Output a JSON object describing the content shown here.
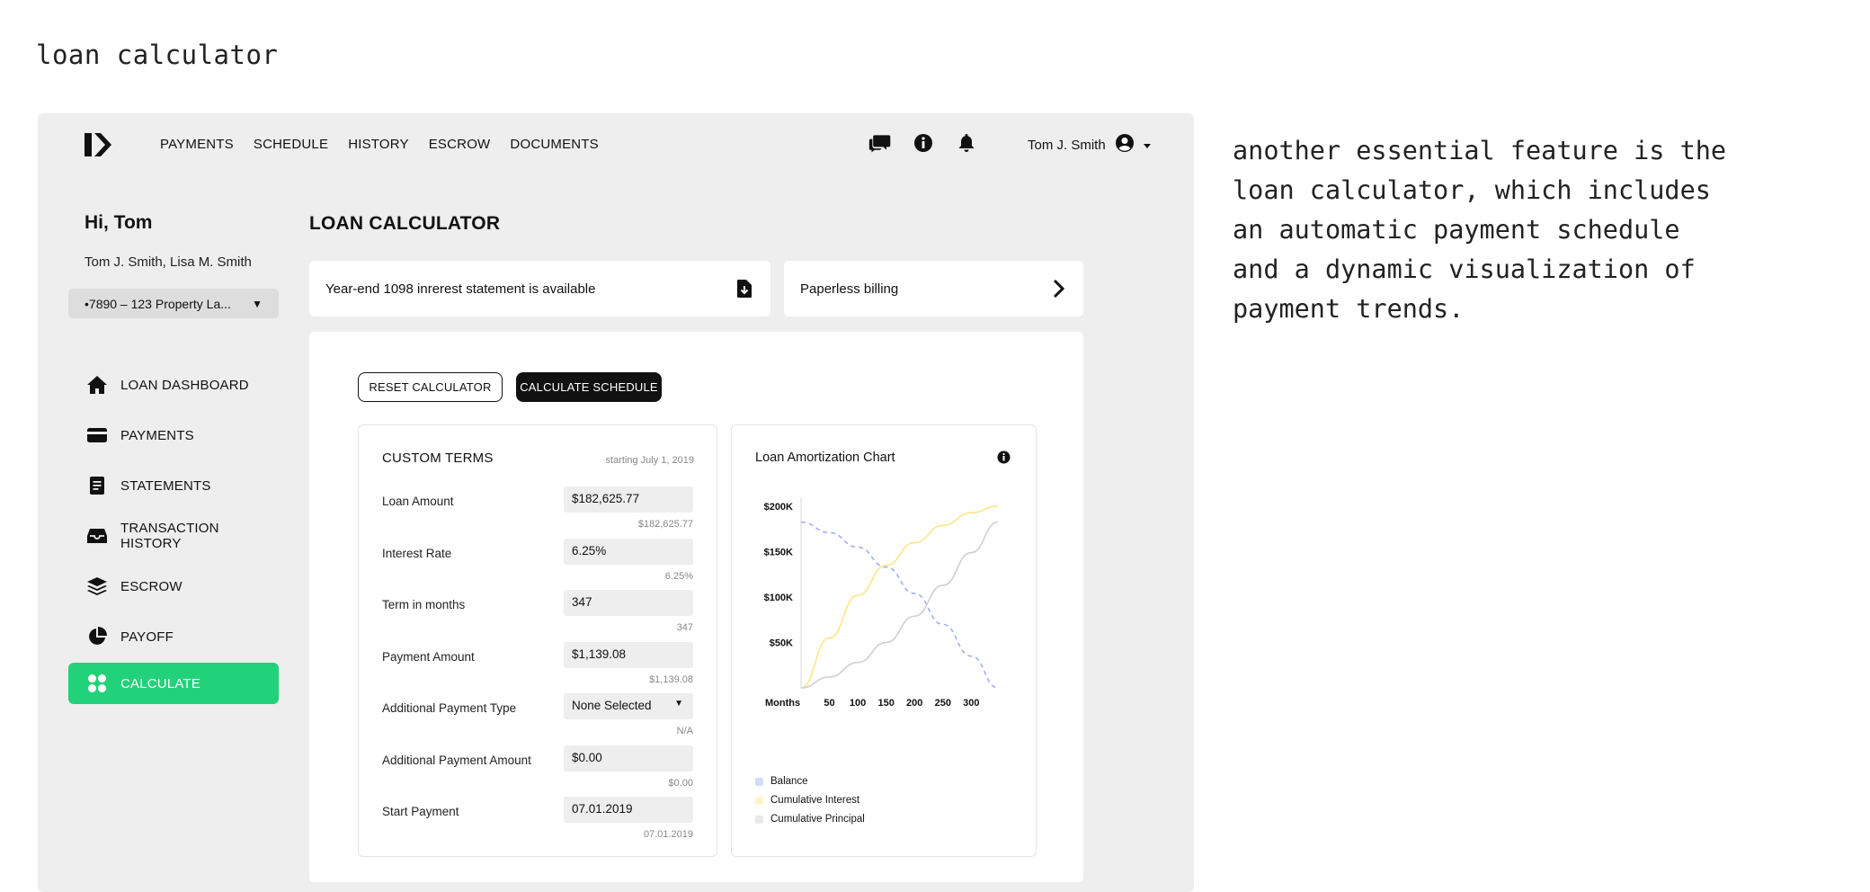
{
  "page": {
    "heading": "loan calculator",
    "note": "another essential feature is the loan calculator, which includes an automatic payment schedule and a dynamic visualization of payment trends."
  },
  "nav": {
    "links": [
      "PAYMENTS",
      "SCHEDULE",
      "HISTORY",
      "ESCROW",
      "DOCUMENTS"
    ],
    "user_name": "Tom J. Smith"
  },
  "sidebar": {
    "greeting": "Hi, Tom",
    "owners": "Tom J. Smith, Lisa M. Smith",
    "property": "•7890 – 123 Property La...",
    "items": [
      {
        "label": "LOAN DASHBOARD",
        "icon": "home-icon"
      },
      {
        "label": "PAYMENTS",
        "icon": "credit-card-icon"
      },
      {
        "label": "STATEMENTS",
        "icon": "document-icon"
      },
      {
        "label": "TRANSACTION HISTORY",
        "icon": "inbox-icon"
      },
      {
        "label": "ESCROW",
        "icon": "layers-icon"
      },
      {
        "label": "PAYOFF",
        "icon": "pie-chart-icon"
      },
      {
        "label": "CALCULATE",
        "icon": "grid-icon",
        "active": true
      }
    ]
  },
  "main": {
    "title": "LOAN CALCULATOR",
    "notices": {
      "statement": "Year-end 1098 inrerest statement is available",
      "paperless": "Paperless billing"
    },
    "buttons": {
      "reset": "RESET CALCULATOR",
      "calculate": "CALCULATE SCHEDULE"
    },
    "terms": {
      "title": "CUSTOM TERMS",
      "subtitle": "starting July 1, 2019",
      "rows": [
        {
          "label": "Loan Amount",
          "value": "$182,625.77",
          "hint": "$182,625.77"
        },
        {
          "label": "Interest Rate",
          "value": "6.25%",
          "hint": "6.25%"
        },
        {
          "label": "Term in months",
          "value": "347",
          "hint": "347"
        },
        {
          "label": "Payment Amount",
          "value": "$1,139.08",
          "hint": "$1,139.08"
        },
        {
          "label": "Additional Payment Type",
          "value": "None Selected",
          "hint": "N/A",
          "select": true
        },
        {
          "label": "Additional Payment Amount",
          "value": "$0.00",
          "hint": "$0.00"
        },
        {
          "label": "Start Payment",
          "value": "07.01.2019",
          "hint": "07.01.2019"
        }
      ]
    }
  },
  "colors": {
    "accent": "#22d27a",
    "balance": "#9fb0ee",
    "interest": "#fde58a",
    "principal": "#cfcfcf"
  },
  "chart_data": {
    "type": "line",
    "title": "Loan Amortization Chart",
    "xlabel": "Months",
    "xlim": [
      0,
      347
    ],
    "ylim": [
      0,
      210000
    ],
    "x_ticks": [
      50,
      100,
      150,
      200,
      250,
      300
    ],
    "y_ticks": [
      {
        "value": 50000,
        "label": "$50K"
      },
      {
        "value": 100000,
        "label": "$100K"
      },
      {
        "value": 150000,
        "label": "$150K"
      },
      {
        "value": 200000,
        "label": "$200K"
      }
    ],
    "series": [
      {
        "name": "Balance",
        "dashed": true,
        "color": "#9fb0ee",
        "x": [
          0,
          50,
          100,
          150,
          200,
          250,
          300,
          347
        ],
        "values": [
          182626,
          171000,
          155000,
          133000,
          104000,
          70000,
          35000,
          0
        ]
      },
      {
        "name": "Cumulative Interest",
        "color": "#fde58a",
        "x": [
          0,
          50,
          100,
          150,
          200,
          250,
          300,
          347
        ],
        "values": [
          0,
          55000,
          102000,
          135000,
          160000,
          179000,
          193000,
          200000
        ]
      },
      {
        "name": "Cumulative Principal",
        "color": "#cfcfcf",
        "x": [
          0,
          50,
          100,
          150,
          200,
          250,
          300,
          347
        ],
        "values": [
          0,
          12000,
          28000,
          50000,
          79000,
          113000,
          149000,
          182626
        ]
      }
    ],
    "legend": "bottom-left"
  }
}
